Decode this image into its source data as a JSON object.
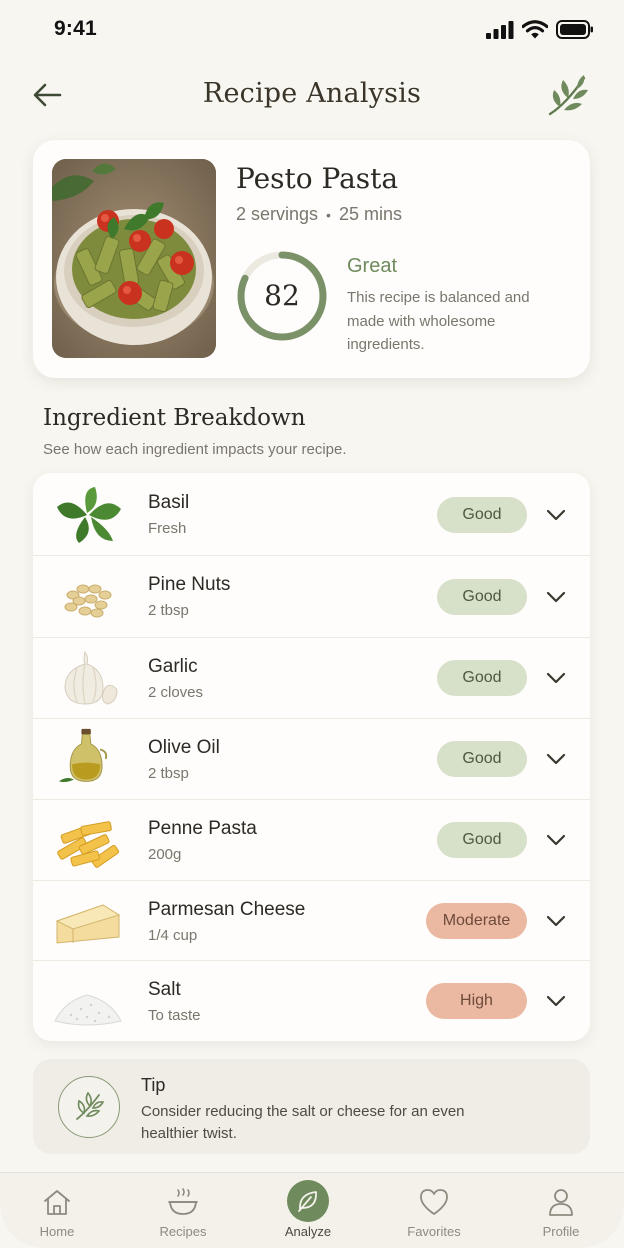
{
  "status_bar": {
    "time": "9:41"
  },
  "header": {
    "title": "Recipe Analysis"
  },
  "recipe": {
    "name": "Pesto Pasta",
    "servings": "2 servings",
    "duration": "25 mins",
    "score": "82",
    "score_fraction": 0.82,
    "rating": "Great",
    "description": "This recipe is balanced and made with wholesome ingredients."
  },
  "breakdown": {
    "title": "Ingredient Breakdown",
    "subtitle": "See how each ingredient impacts your recipe.",
    "items": [
      {
        "name": "Basil",
        "qty": "Fresh",
        "rating": "Good"
      },
      {
        "name": "Pine Nuts",
        "qty": "2 tbsp",
        "rating": "Good"
      },
      {
        "name": "Garlic",
        "qty": "2 cloves",
        "rating": "Good"
      },
      {
        "name": "Olive Oil",
        "qty": "2 tbsp",
        "rating": "Good"
      },
      {
        "name": "Penne Pasta",
        "qty": "200g",
        "rating": "Good"
      },
      {
        "name": "Parmesan Cheese",
        "qty": "1/4 cup",
        "rating": "Moderate"
      },
      {
        "name": "Salt",
        "qty": "To taste",
        "rating": "High"
      }
    ]
  },
  "tip": {
    "title": "Tip",
    "text": "Consider reducing the salt or cheese for an even healthier twist."
  },
  "nav": {
    "items": [
      {
        "label": "Home",
        "icon": "home-icon"
      },
      {
        "label": "Recipes",
        "icon": "bowl-icon"
      },
      {
        "label": "Analyze",
        "icon": "leaf-icon"
      },
      {
        "label": "Favorites",
        "icon": "heart-icon"
      },
      {
        "label": "Profile",
        "icon": "user-icon"
      }
    ],
    "active": "Analyze"
  },
  "colors": {
    "accent": "#6f8a5c",
    "good_badge": "#d7e0c9",
    "warn_badge": "#ebb9a2",
    "background": "#f8f6f1"
  }
}
